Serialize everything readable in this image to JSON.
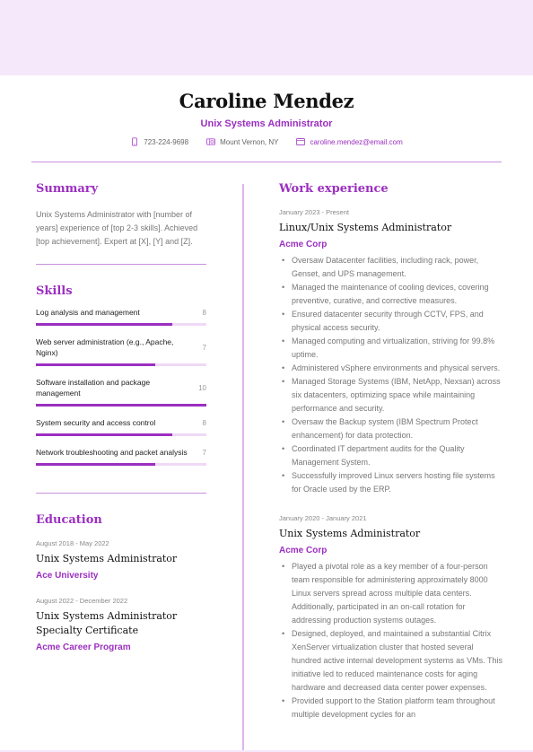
{
  "header": {
    "name": "Caroline Mendez",
    "title": "Unix Systems Administrator",
    "contacts": {
      "phone": {
        "icon": "phone-icon",
        "value": "723-224-9698"
      },
      "location": {
        "icon": "address-card-icon",
        "value": "Mount Vernon, NY"
      },
      "email": {
        "icon": "envelope-icon",
        "value": "caroline.mendez@email.com"
      }
    }
  },
  "colors": {
    "accent": "#9b2fc0",
    "band": "#f6e8fb",
    "rule": "#c98fdc"
  },
  "summary": {
    "title": "Summary",
    "text": "Unix Systems Administrator with [number of years] experience of [top 2-3 skills]. Achieved [top achievement]. Expert at [X], [Y] and [Z]."
  },
  "skills": {
    "title": "Skills",
    "max": 10,
    "items": [
      {
        "name": "Log analysis and management",
        "level": 8
      },
      {
        "name": "Web server administration (e.g., Apache, Nginx)",
        "level": 7
      },
      {
        "name": "Software installation and package management",
        "level": 10
      },
      {
        "name": "System security and access control",
        "level": 8
      },
      {
        "name": "Network troubleshooting and packet analysis",
        "level": 7
      }
    ]
  },
  "education": {
    "title": "Education",
    "items": [
      {
        "date": "August 2018 - May 2022",
        "role": "Unix Systems Administrator",
        "org": "Ace University"
      },
      {
        "date": "August 2022 - December 2022",
        "role": "Unix Systems Administrator Specialty Certificate",
        "org": "Acme Career Program"
      }
    ]
  },
  "work": {
    "title": "Work experience",
    "items": [
      {
        "date": "January 2023 - Present",
        "role": "Linux/Unix Systems Administrator",
        "org": "Acme Corp",
        "bullets": [
          "Oversaw Datacenter facilities, including rack, power, Genset, and UPS management.",
          "Managed the maintenance of cooling devices, covering preventive, curative, and corrective measures.",
          "Ensured datacenter security through CCTV, FPS, and physical access security.",
          "Managed computing and virtualization, striving for 99.8% uptime.",
          "Administered vSphere environments and physical servers.",
          "Managed Storage Systems (IBM, NetApp, Nexsan) across six datacenters, optimizing space while maintaining performance and security.",
          "Oversaw the Backup system (IBM Spectrum Protect enhancement) for data protection.",
          "Coordinated IT department audits for the Quality Management System.",
          "Successfully improved Linux servers hosting file systems for Oracle used by the ERP."
        ]
      },
      {
        "date": "January 2020 - January 2021",
        "role": "Unix Systems Administrator",
        "org": "Acme Corp",
        "bullets": [
          "Played a pivotal role as a key member of a four-person team responsible for administering approximately 8000 Linux servers spread across multiple data centers. Additionally, participated in an on-call rotation for addressing production systems outages.",
          "Designed, deployed, and maintained a substantial Citrix XenServer virtualization cluster that hosted several hundred active internal development systems as VMs. This initiative led to reduced maintenance costs for aging hardware and decreased data center power expenses.",
          "Provided support to the Station platform team throughout multiple development cycles for an"
        ]
      }
    ]
  }
}
